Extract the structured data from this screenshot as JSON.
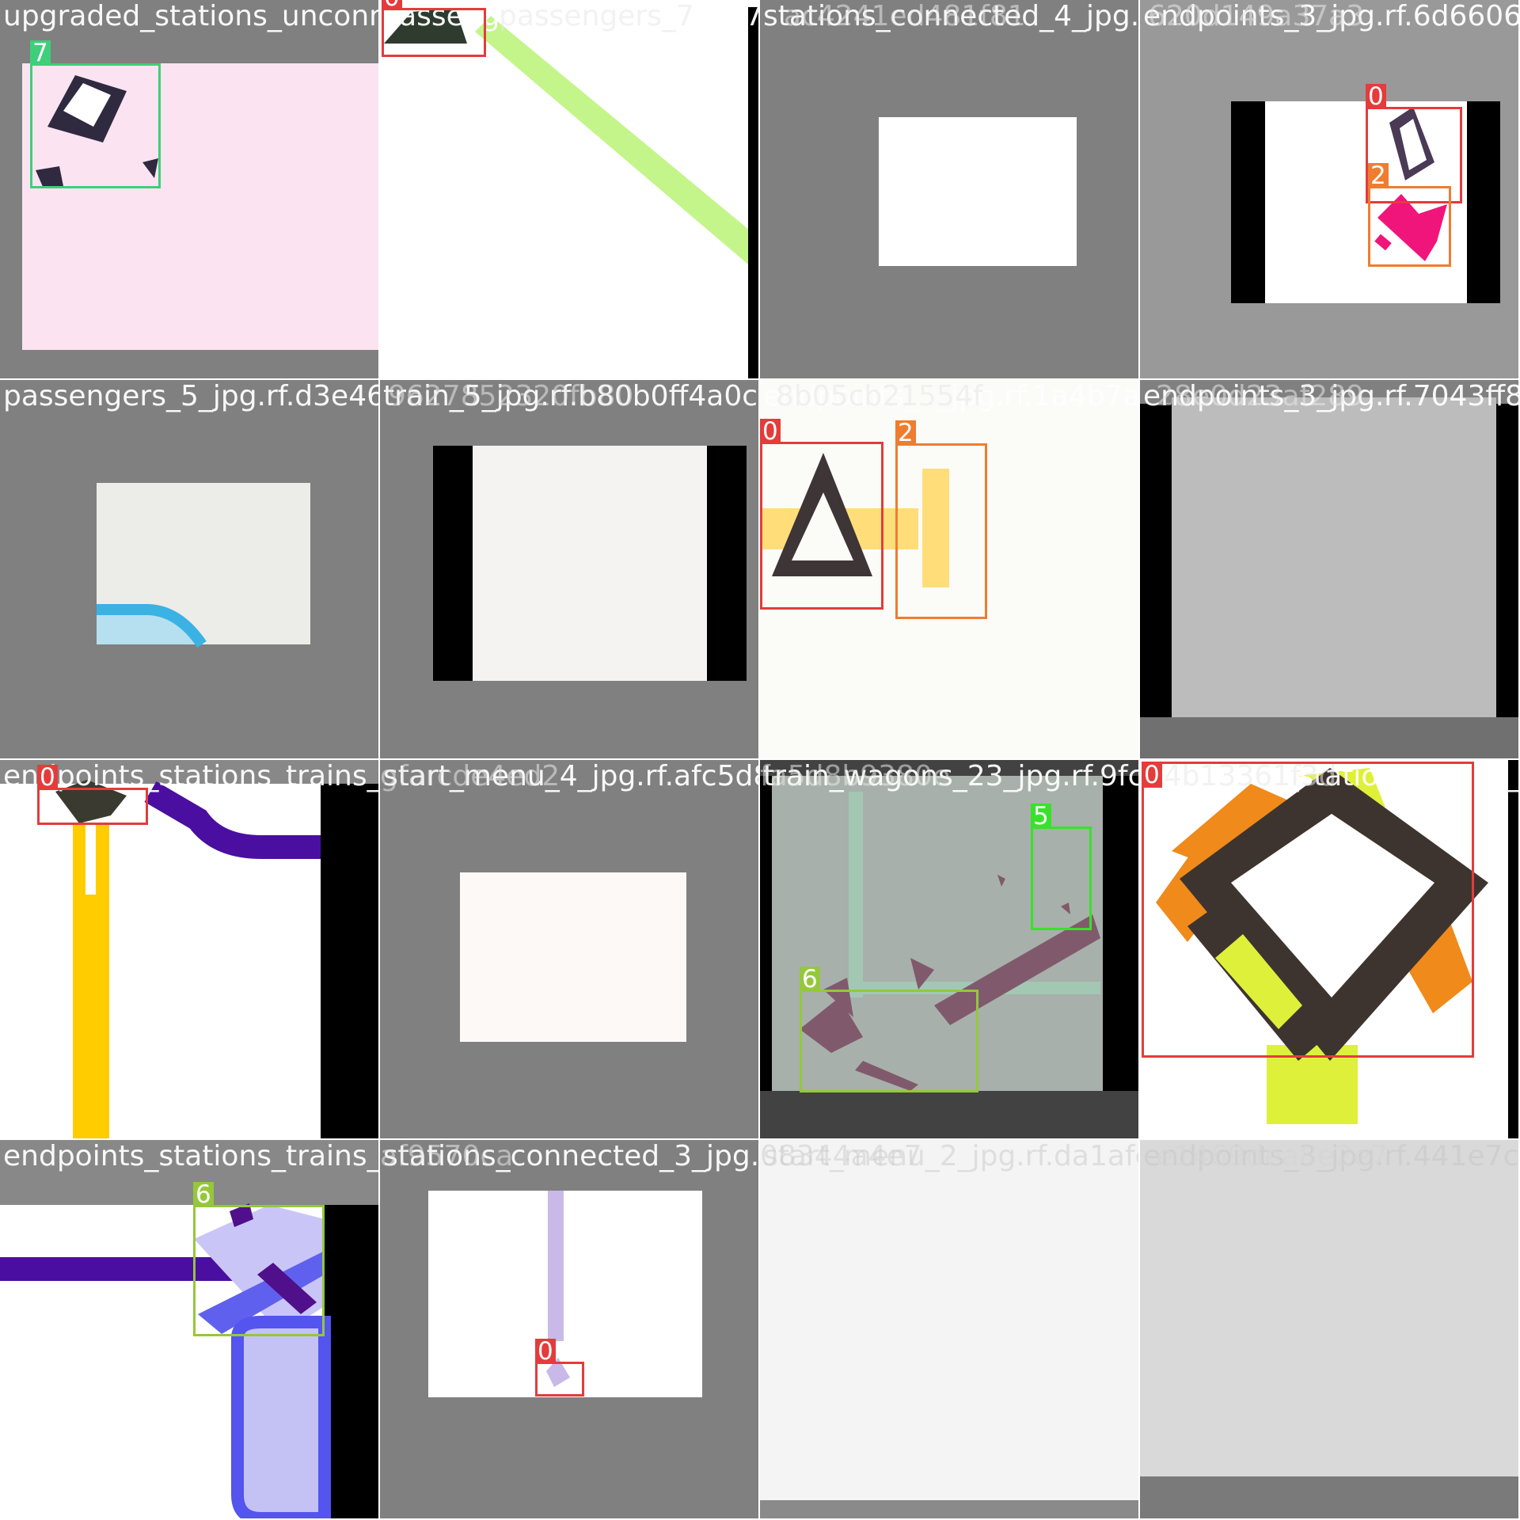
{
  "grid": {
    "rows": 4,
    "cols": 4
  },
  "class_colors": {
    "0": "#e53b3b",
    "2": "#ef7d2f",
    "5": "#38e22a",
    "6": "#94c83a",
    "7": "#3dcf7a"
  },
  "tiles": [
    {
      "label": "upgraded_stations_unconne",
      "detections": [
        {
          "cls": "7"
        }
      ]
    },
    {
      "label": "Passengers_3_jpg.rf.92577",
      "overlap_label": "passengers_7",
      "detections": [
        {
          "cls": "0"
        }
      ]
    },
    {
      "label": "stations_connected_4_jpg.rf.",
      "overlap_label": "ac4241ed481f81",
      "detections": []
    },
    {
      "label": "endpoints_3_jpg.rf.6d6606d",
      "overlap_label": "620d149a37a3",
      "detections": [
        {
          "cls": "0"
        },
        {
          "cls": "2"
        }
      ]
    },
    {
      "label": "passengers_5_jpg.rf.d3e467",
      "detections": []
    },
    {
      "label": "train_5_jpg.rf.b80b0ff4a0c00",
      "overlap_label": "9627852320fb80",
      "detections": []
    },
    {
      "label": "endpoints_5_jpg.rf.1a4b7ade",
      "overlap_label": "8b05cb21554f",
      "detections": [
        {
          "cls": "0"
        },
        {
          "cls": "2"
        }
      ]
    },
    {
      "label": "endpoints_3_jpg.rf.7043ff8",
      "overlap_label": "28e0d23af289",
      "detections": []
    },
    {
      "label": "endpoints_stations_trains_jp",
      "detections": [
        {
          "cls": "0"
        }
      ]
    },
    {
      "label": "start_menu_4_jpg.rf.afc5d8b",
      "overlap_label": "gfarcde4ed2",
      "detections": []
    },
    {
      "label": "train_wagons_23_jpg.rf.9fcc",
      "overlap_label": "fa5d8b9380e",
      "detections": [
        {
          "cls": "5"
        },
        {
          "cls": "6"
        }
      ]
    },
    {
      "label": "endpoints_stations_trains_2",
      "overlap_label": "c4b13361f3d",
      "detections": [
        {
          "cls": "0"
        }
      ]
    },
    {
      "label": "endpoints_stations_trains_jp",
      "detections": [
        {
          "cls": "6"
        }
      ]
    },
    {
      "label": "stations_connected_3_jpg.rf.",
      "overlap_label": "af9570ca",
      "detections": [
        {
          "cls": "0"
        }
      ]
    },
    {
      "label": "start_menu_2_jpg.rf.da1afc",
      "overlap_label": "08344a4e7",
      "detections": []
    },
    {
      "label": "endpoints_3_jpg.rf.441e7c",
      "overlap_label": "e1469dea8e2e7",
      "detections": []
    }
  ]
}
